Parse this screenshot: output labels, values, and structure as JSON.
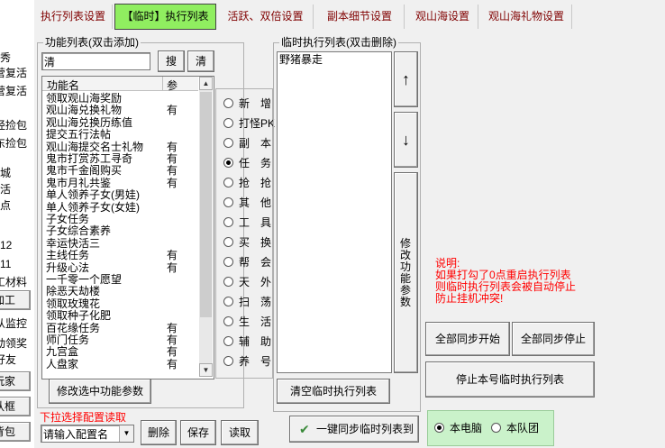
{
  "left_strip": {
    "items": [
      "秀",
      "营复活",
      "营复活",
      "经捡包",
      "东捡包",
      "城",
      "活",
      "点",
      "12",
      "11",
      "工材料"
    ],
    "buttons": [
      "加工",
      "从监控",
      "动领奖",
      "好友",
      "玩家",
      "队框",
      "背包"
    ]
  },
  "tabs": [
    {
      "label": "执行列表设置",
      "active": false
    },
    {
      "label": "【临时】执行列表",
      "active": true
    },
    {
      "label": "活跃、双倍设置",
      "active": false
    },
    {
      "label": "副本细节设置",
      "active": false
    },
    {
      "label": "观山海设置",
      "active": false
    },
    {
      "label": "观山海礼物设置",
      "active": false
    }
  ],
  "function_group": {
    "legend": "功能列表(双击添加)",
    "search_value": "清",
    "search_button": "搜",
    "clear_button": "清",
    "columns": [
      "功能名",
      "参"
    ],
    "rows": [
      {
        "name": "领取观山海奖励",
        "param": ""
      },
      {
        "name": "观山海兑换礼物",
        "param": "有"
      },
      {
        "name": "观山海兑换历练值",
        "param": ""
      },
      {
        "name": "提交五行法帖",
        "param": ""
      },
      {
        "name": "观山海提交名士礼物",
        "param": "有"
      },
      {
        "name": "鬼市打赏苏工寻奇",
        "param": "有"
      },
      {
        "name": "鬼市千金阁购买",
        "param": "有"
      },
      {
        "name": "鬼市月礼共鉴",
        "param": "有"
      },
      {
        "name": "单人领养子女(男娃)",
        "param": ""
      },
      {
        "name": "单人领养子女(女娃)",
        "param": ""
      },
      {
        "name": "子女任务",
        "param": ""
      },
      {
        "name": "子女综合素养",
        "param": ""
      },
      {
        "name": "幸运快活三",
        "param": ""
      },
      {
        "name": "主线任务",
        "param": "有"
      },
      {
        "name": "升级心法",
        "param": "有"
      },
      {
        "name": "一千零一个愿望",
        "param": ""
      },
      {
        "name": "除恶天劫楼",
        "param": ""
      },
      {
        "name": "领取玫瑰花",
        "param": ""
      },
      {
        "name": "领取种子化肥",
        "param": ""
      },
      {
        "name": "百花缘任务",
        "param": "有"
      },
      {
        "name": "师门任务",
        "param": "有"
      },
      {
        "name": "九宫盒",
        "param": "有"
      },
      {
        "name": "人盘家",
        "param": "有"
      }
    ],
    "categories": [
      {
        "label": "新　增",
        "checked": false
      },
      {
        "label": "打怪PK",
        "checked": false
      },
      {
        "label": "副　本",
        "checked": false
      },
      {
        "label": "任　务",
        "checked": true
      },
      {
        "label": "抢　抢",
        "checked": false
      },
      {
        "label": "其　他",
        "checked": false
      },
      {
        "label": "工　具",
        "checked": false
      },
      {
        "label": "买　换",
        "checked": false
      },
      {
        "label": "帮　会",
        "checked": false
      },
      {
        "label": "天　外",
        "checked": false
      },
      {
        "label": "扫　荡",
        "checked": false
      },
      {
        "label": "生　活",
        "checked": false
      },
      {
        "label": "辅　助",
        "checked": false
      },
      {
        "label": "养　号",
        "checked": false
      }
    ],
    "modify_button": "修改选中功能参数"
  },
  "config": {
    "label": "下拉选择配置读取",
    "placeholder": "请输入配置名",
    "delete_button": "删除",
    "save_button": "保存",
    "read_button": "读取"
  },
  "temp_group": {
    "legend": "临时执行列表(双击删除)",
    "items": [
      "野猪暴走"
    ],
    "up_arrow": "↑",
    "down_arrow": "↓",
    "modify_button": "修改功能参数",
    "clear_button": "清空临时执行列表"
  },
  "sync_button": "一键同步临时列表到",
  "note": {
    "title": "说明:",
    "lines": [
      "如果打勾了0点重启执行列表",
      "则临时执行列表会被自动停止",
      "防止挂机冲突!"
    ]
  },
  "actions": {
    "start_all": "全部同步开始",
    "stop_all": "全部同步停止",
    "stop_this": "停止本号临时执行列表"
  },
  "scope": {
    "options": [
      {
        "label": "本电脑",
        "checked": true
      },
      {
        "label": "本队团",
        "checked": false
      }
    ]
  },
  "colors": {
    "active_tab": "#90ee60",
    "tab_text": "#800000",
    "note_text": "#ff0000",
    "panel_bg": "#f0f0f0"
  }
}
